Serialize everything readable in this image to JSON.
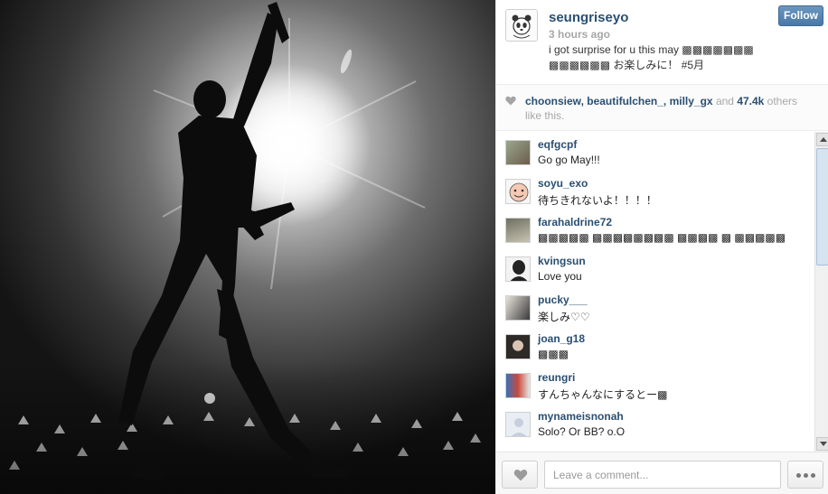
{
  "post": {
    "username": "seungriseyo",
    "time": "3 hours ago",
    "caption": "i got surprise for u this may ▩▩▩▩▩▩▩ ▩▩▩▩▩▩ お楽しみに！ #5月",
    "follow_label": "Follow"
  },
  "likes": {
    "names": "choonsiew, beautifulchen_, milly_gx",
    "and": " and ",
    "count": "47.4k",
    "suffix": " others like this."
  },
  "comments": [
    {
      "user": "eqfgcpf",
      "text": "Go go May!!!"
    },
    {
      "user": "soyu_exo",
      "text": "待ちきれないよ！！！！"
    },
    {
      "user": "farahaldrine72",
      "text": "▩▩▩▩▩ ▩▩▩▩▩▩▩▩ ▩▩▩▩ ▩ ▩▩▩▩▩"
    },
    {
      "user": "kvingsun",
      "text": "Love you"
    },
    {
      "user": "pucky___",
      "text": "楽しみ♡♡"
    },
    {
      "user": "joan_g18",
      "text": "▩▩▩"
    },
    {
      "user": "reungri",
      "text": "すんちゃんなにするとー▩"
    },
    {
      "user": "mynameisnonah",
      "text": "Solo? Or BB? o.O"
    }
  ],
  "footer": {
    "comment_placeholder": "Leave a comment..."
  },
  "colors": {
    "link": "#2a4f72",
    "follow": "#4a79a6",
    "muted": "#a7a7a7"
  },
  "icons": [
    "heart-icon",
    "more-dots-icon",
    "scroll-up-arrow-icon",
    "scroll-down-arrow-icon"
  ]
}
